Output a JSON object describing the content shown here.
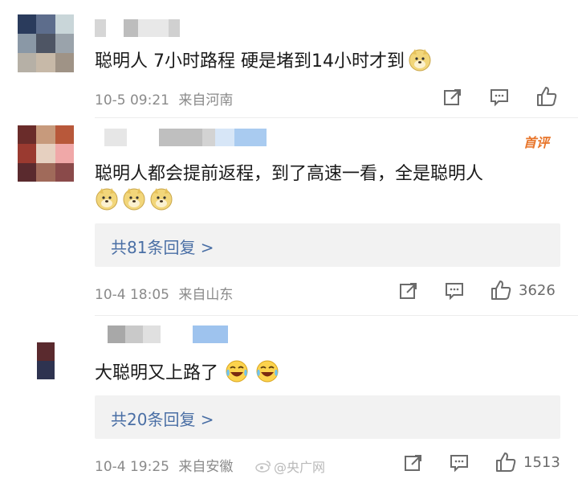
{
  "comments": [
    {
      "text": "聪明人 7小时路程 硬是堵到14小时才到",
      "date": "10-5 09:21",
      "location": "来自河南",
      "icons": [
        "share-icon",
        "comment-icon",
        "like-icon"
      ]
    },
    {
      "badge": "首评",
      "text": "聪明人都会提前返程，到了高速一看，全是聪明人",
      "replies": "共81条回复 >",
      "date": "10-4 18:05",
      "location": "来自山东",
      "likes": "3626"
    },
    {
      "text": "大聪明又上路了",
      "replies": "共20条回复 >",
      "date": "10-4 19:25",
      "location": "来自安徽",
      "likes": "1513"
    }
  ],
  "watermark": "@央广网",
  "colors": {
    "link": "#4a6fa5",
    "meta": "#8a8a8a",
    "badge": "#e8752a",
    "reply_bg": "#f2f2f2"
  }
}
